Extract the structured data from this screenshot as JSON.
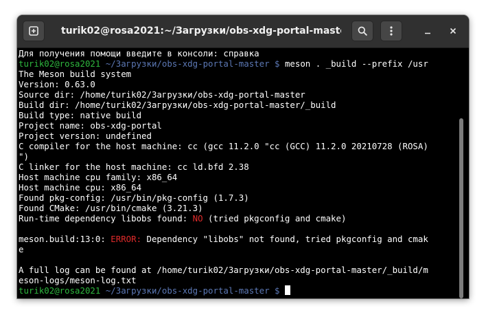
{
  "window": {
    "title": "turik02@rosa2021:~/Загрузки/obs-xdg-portal-master",
    "new_tab_icon": "new-tab-icon",
    "search_icon": "search-icon",
    "menu_icon": "kebab-menu-icon",
    "minimize_icon": "minimize-icon",
    "close_icon": "close-icon"
  },
  "terminal": {
    "help": "Для получения помощи введите в консоли: справка",
    "prompt_user": "turik02@rosa2021",
    "prompt_path": "~/Загрузки/obs-xdg-portal-master $",
    "command": "meson . _build --prefix /usr",
    "out": [
      "The Meson build system",
      "Version: 0.63.0",
      "Source dir: /home/turik02/Загрузки/obs-xdg-portal-master",
      "Build dir: /home/turik02/Загрузки/obs-xdg-portal-master/_build",
      "Build type: native build",
      "Project name: obs-xdg-portal",
      "Project version: undefined",
      "C compiler for the host machine: cc (gcc 11.2.0 \"cc (GCC) 11.2.0 20210728 (ROSA)",
      "\")",
      "C linker for the host machine: cc ld.bfd 2.38",
      "Host machine cpu family: x86_64",
      "Host machine cpu: x86_64",
      "Found pkg-config: /usr/bin/pkg-config (1.7.3)",
      "Found CMake: /usr/bin/cmake (3.21.3)"
    ],
    "dep_prefix": "Run-time dependency libobs found: ",
    "dep_no": "NO",
    "dep_suffix": " (tried pkgconfig and cmake)",
    "err_prefix": "meson.build:13:0: ",
    "err_label": "ERROR:",
    "err_msg": " Dependency \"libobs\" not found, tried pkgconfig and cmak",
    "err_wrap": "e",
    "log_line1": "A full log can be found at /home/turik02/Загрузки/obs-xdg-portal-master/_build/m",
    "log_line2": "eson-logs/meson-log.txt"
  },
  "colors": {
    "prompt_user": "#2eb83e",
    "prompt_path": "#5c78b5",
    "error": "#e02b2b",
    "background": "#000000",
    "headerbar": "#303030"
  }
}
